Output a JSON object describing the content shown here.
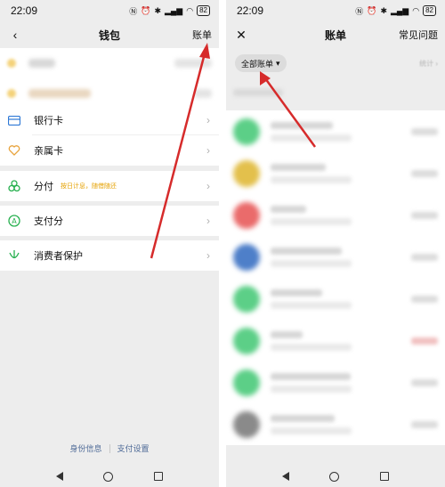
{
  "left_screen": {
    "status": {
      "time": "22:09",
      "signal": "⁵ᴳ",
      "battery": "82"
    },
    "nav": {
      "back_icon": "chevron-left-icon",
      "title": "钱包",
      "bill_link": "账单"
    },
    "menu": [
      {
        "label": "银行卡",
        "icon": "bank-card-icon",
        "icon_color": "#2f79d6",
        "tag": ""
      },
      {
        "label": "亲属卡",
        "icon": "family-card-icon",
        "icon_color": "#e8a33c",
        "tag": ""
      },
      {
        "label": "分付",
        "icon": "fenfu-icon",
        "icon_color": "#27b04f",
        "tag": "按日计息，随借随还"
      },
      {
        "label": "支付分",
        "icon": "pay-score-icon",
        "icon_color": "#27b04f",
        "tag": ""
      },
      {
        "label": "消费者保护",
        "icon": "consumer-protection-icon",
        "icon_color": "#27b04f",
        "tag": ""
      }
    ],
    "footer": {
      "identity": "身份信息",
      "pay_settings": "支付设置"
    }
  },
  "right_screen": {
    "status": {
      "time": "22:09",
      "signal": "⁵ᴳ",
      "battery": "82"
    },
    "nav": {
      "close_icon": "close-icon",
      "title": "账单",
      "faq_link": "常见问题"
    },
    "filter": {
      "label": "全部账单",
      "caret": "▾"
    },
    "stats_link": "统计 ›",
    "bill_avatar_colors": [
      "#5ccf87",
      "#e3c04c",
      "#ea6b6b",
      "#4e7fc9",
      "#5ccf87",
      "#5ccf87",
      "#5ccf87",
      "#8a8a8a"
    ]
  },
  "annotation_color": "#d62b2b"
}
